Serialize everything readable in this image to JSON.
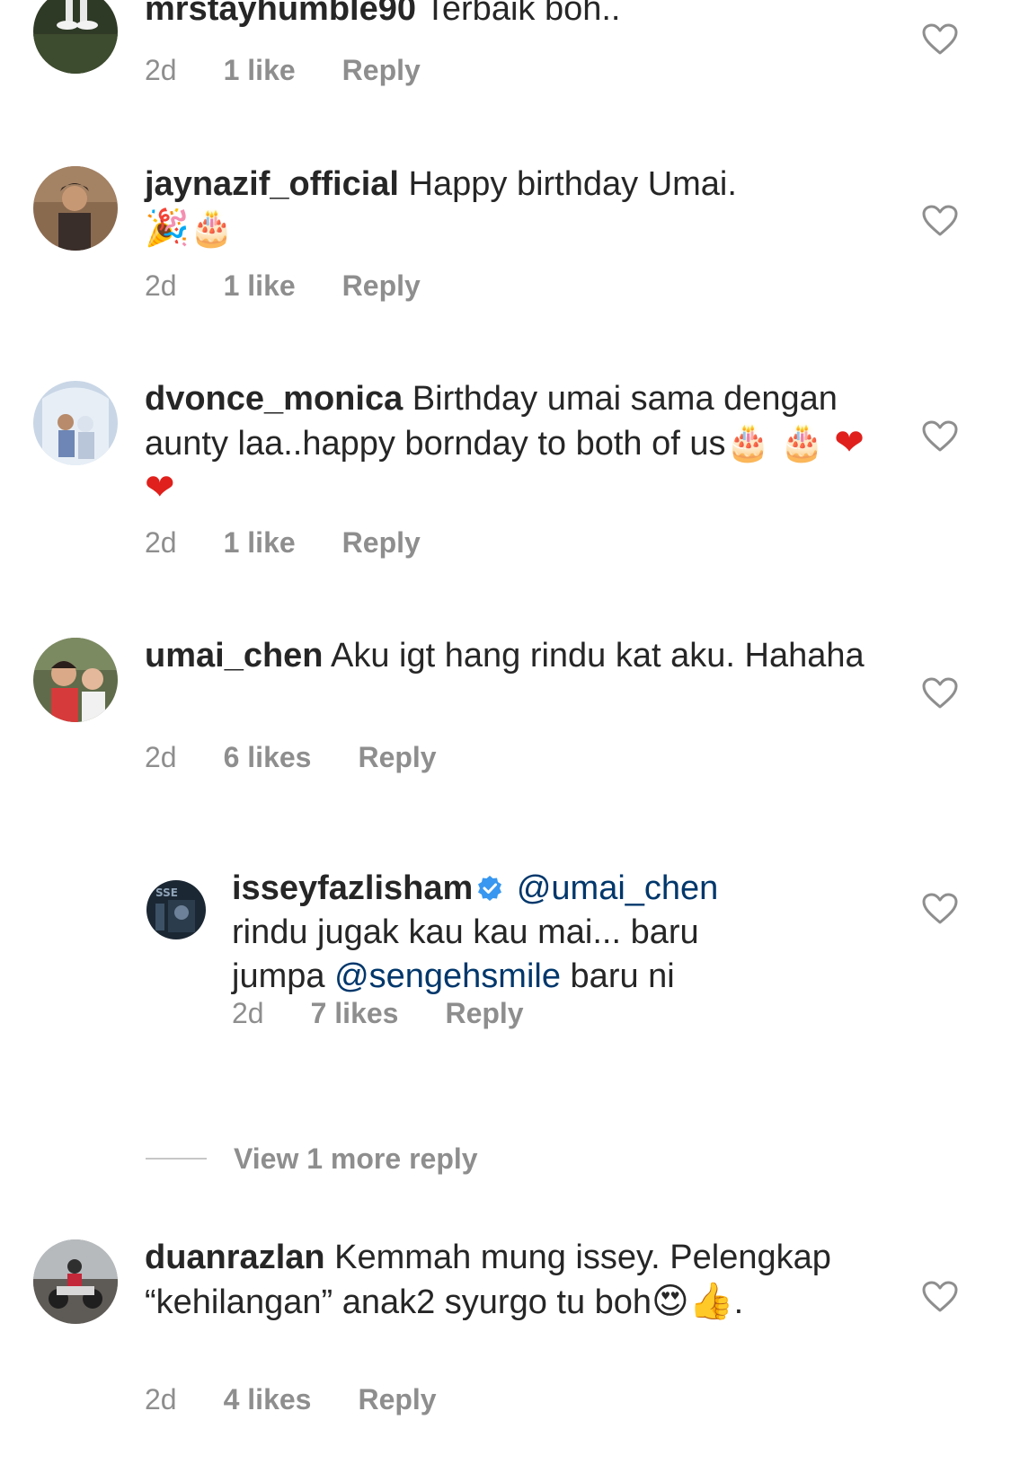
{
  "colors": {
    "text": "#262626",
    "secondary": "#8e8e8e",
    "mention": "#00376b",
    "verified": "#3897f0"
  },
  "comments": [
    {
      "username": "mrstayhumble90",
      "text": "Terbaik boh..",
      "time": "2d",
      "likes": "1 like",
      "reply": "Reply"
    },
    {
      "username": "jaynazif_official",
      "text": "Happy birthday Umai.",
      "emoji": [
        "party-popper",
        "birthday-cake"
      ],
      "time": "2d",
      "likes": "1 like",
      "reply": "Reply"
    },
    {
      "username": "dvonce_monica",
      "text": "Birthday umai sama dengan aunty laa..happy bornday to both of us",
      "emoji": [
        "birthday-cake",
        "birthday-cake",
        "red-heart",
        "red-heart"
      ],
      "time": "2d",
      "likes": "1 like",
      "reply": "Reply"
    },
    {
      "username": "umai_chen",
      "text": "Aku igt hang rindu kat aku. Hahaha",
      "time": "2d",
      "likes": "6 likes",
      "reply": "Reply"
    },
    {
      "username": "isseyfazlisham",
      "verified": true,
      "mention_1": "@umai_chen",
      "text_1": "rindu jugak kau kau mai... baru jumpa",
      "mention_2": "@sengehsmile",
      "text_2": "baru ni",
      "time": "2d",
      "likes": "7 likes",
      "reply": "Reply"
    },
    {
      "username": "duanrazlan",
      "text": "Kemmah mung issey. Pelengkap “kehilangan” anak2 syurgo tu boh",
      "emoji": [
        "heart-eyes-face",
        "thumbs-up"
      ],
      "trailing": ".",
      "time": "2d",
      "likes": "4 likes",
      "reply": "Reply"
    }
  ],
  "view_more_replies": "View 1 more reply"
}
